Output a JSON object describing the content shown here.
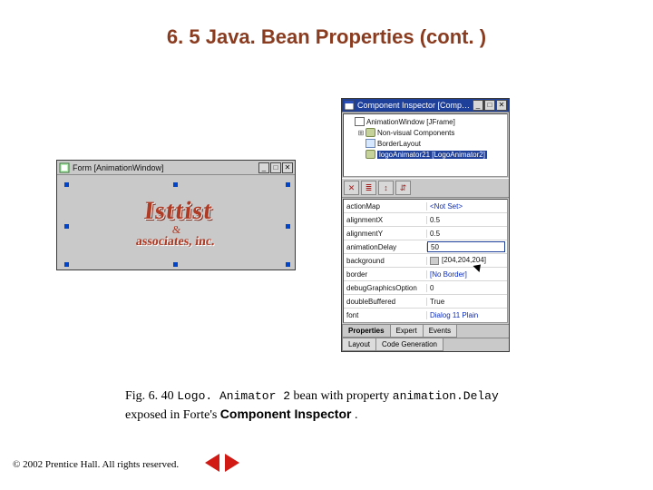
{
  "title": "6. 5   Java. Bean Properties (cont. )",
  "form_window": {
    "title": "Form [AnimationWindow]",
    "logo_line1": "Isttist",
    "logo_amp": "&",
    "logo_line2": "associates, inc."
  },
  "inspector": {
    "title": "Component Inspector [Comp…",
    "tree": [
      {
        "glyph": "",
        "indent": 0,
        "label": "AnimationWindow [JFrame]",
        "icon": "frame",
        "selected": false
      },
      {
        "glyph": "⊞",
        "indent": 1,
        "label": "Non-visual Components",
        "icon": "bean",
        "selected": false
      },
      {
        "glyph": "",
        "indent": 1,
        "label": "BorderLayout",
        "icon": "layout",
        "selected": false
      },
      {
        "glyph": "",
        "indent": 1,
        "label": "logoAnimator21 [LogoAnimator2]",
        "icon": "bean",
        "selected": true
      }
    ],
    "tool_icons": [
      "✕",
      "≣",
      "↕",
      "⇵"
    ],
    "properties": [
      {
        "name": "actionMap",
        "value": "<Not Set>",
        "link": true
      },
      {
        "name": "alignmentX",
        "value": "0.5"
      },
      {
        "name": "alignmentY",
        "value": "0.5"
      },
      {
        "name": "animationDelay",
        "value": "50",
        "selected": true
      },
      {
        "name": "background",
        "value": "[204,204,204]",
        "swatch": true
      },
      {
        "name": "border",
        "value": "[No Border]",
        "link": true
      },
      {
        "name": "debugGraphicsOption",
        "value": "0"
      },
      {
        "name": "doubleBuffered",
        "value": "True"
      },
      {
        "name": "font",
        "value": "Dialog 11 Plain",
        "link": true
      }
    ],
    "tabs_row1": [
      "Properties",
      "Expert",
      "Events"
    ],
    "tabs_row2": [
      "Layout",
      "Code Generation"
    ]
  },
  "caption": {
    "prefix": "Fig. 6. 40 ",
    "code1": "Logo. Animator 2",
    "mid": " bean with property ",
    "code2": "animation.Delay",
    "line2a": "exposed in Forte's ",
    "bold": "Component Inspector",
    "line2b": "."
  },
  "footer": "© 2002 Prentice Hall.  All rights reserved."
}
